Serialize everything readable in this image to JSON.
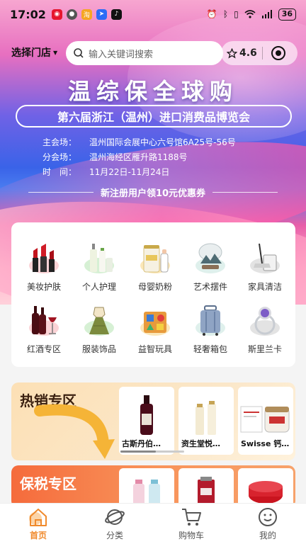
{
  "status_bar": {
    "time": "17:02",
    "battery": "36"
  },
  "header": {
    "store_select": "选择门店",
    "search_placeholder": "输入关键词搜索",
    "rating": "4.6"
  },
  "banner": {
    "headline": "温综保全球购",
    "expo_name": "第六届浙江（温州）进口消费品博览会",
    "info": [
      {
        "label": "主会场：",
        "value": "温州国际会展中心六号馆6A25号-56号"
      },
      {
        "label": "分会场：",
        "value": "温州海经区雁升路1188号"
      },
      {
        "label": "时　间：",
        "value": "11月22日-11月24日"
      }
    ],
    "coupon_text": "新注册用户领10元优惠券"
  },
  "categories": [
    {
      "label": "美妆护肤",
      "icon": "lipstick-icon"
    },
    {
      "label": "个人护理",
      "icon": "lotion-bottles-icon"
    },
    {
      "label": "母婴奶粉",
      "icon": "milk-powder-icon"
    },
    {
      "label": "艺术摆件",
      "icon": "art-ornament-icon"
    },
    {
      "label": "家具清洁",
      "icon": "mop-icon"
    },
    {
      "label": "红酒专区",
      "icon": "wine-icon"
    },
    {
      "label": "服装饰品",
      "icon": "dress-icon"
    },
    {
      "label": "益智玩具",
      "icon": "toy-blocks-icon"
    },
    {
      "label": "轻奢箱包",
      "icon": "suitcase-icon"
    },
    {
      "label": "斯里兰卡",
      "icon": "gem-ring-icon"
    }
  ],
  "hot_zone": {
    "title": "热销专区",
    "products": [
      {
        "name": "古斯丹伯…"
      },
      {
        "name": "资生堂悦…"
      },
      {
        "name": "Swisse 钙…"
      }
    ]
  },
  "bonded_zone": {
    "title": "保税专区"
  },
  "tabbar": [
    {
      "label": "首页",
      "icon": "home-icon",
      "active": true
    },
    {
      "label": "分类",
      "icon": "planet-icon",
      "active": false
    },
    {
      "label": "购物车",
      "icon": "cart-icon",
      "active": false
    },
    {
      "label": "我的",
      "icon": "smiley-icon",
      "active": false
    }
  ],
  "colors": {
    "accent": "#f08a2c",
    "hot_bg": "#fce0b5",
    "bonded_bg": "#f56b3c"
  }
}
